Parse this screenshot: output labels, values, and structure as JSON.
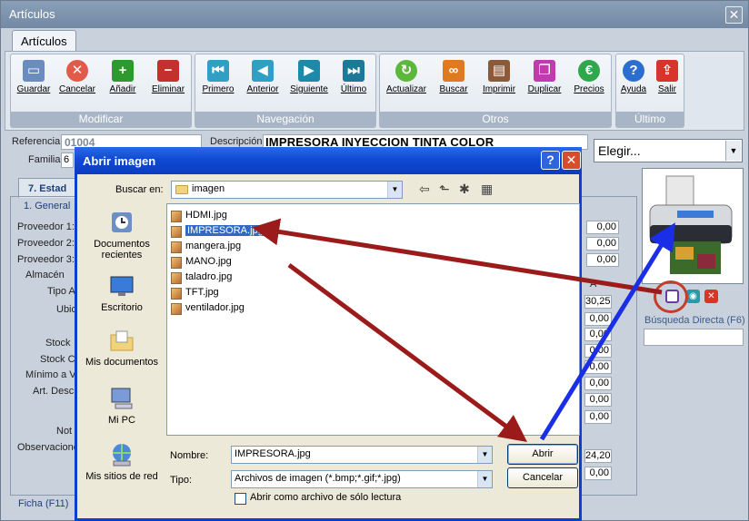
{
  "window": {
    "title": "Artículos",
    "close_glyph": "✕"
  },
  "ribbon": {
    "tab_label": "Artículos",
    "groups": [
      {
        "label": "Modificar",
        "buttons": [
          {
            "label": "Guardar",
            "icon": "save-icon",
            "color": "#6a8cbf"
          },
          {
            "label": "Cancelar",
            "icon": "cancel-icon",
            "color": "#e25a4a"
          },
          {
            "label": "Añadir",
            "icon": "add-icon",
            "color": "#2e9a2e"
          },
          {
            "label": "Eliminar",
            "icon": "delete-icon",
            "color": "#c4302b"
          }
        ]
      },
      {
        "label": "Navegación",
        "buttons": [
          {
            "label": "Primero",
            "icon": "first-icon",
            "color": "#2f9fc4"
          },
          {
            "label": "Anterior",
            "icon": "previous-icon",
            "color": "#2f9fc4"
          },
          {
            "label": "Siguiente",
            "icon": "next-icon",
            "color": "#1c8aa8"
          },
          {
            "label": "Último",
            "icon": "last-icon",
            "color": "#1c7a98"
          }
        ]
      },
      {
        "label": "Otros",
        "buttons": [
          {
            "label": "Actualizar",
            "icon": "refresh-icon",
            "color": "#5cb83a"
          },
          {
            "label": "Buscar",
            "icon": "binoculars-icon",
            "color": "#e07a20"
          },
          {
            "label": "Imprimir",
            "icon": "printer-icon",
            "color": "#8a5a3a"
          },
          {
            "label": "Duplicar",
            "icon": "duplicate-icon",
            "color": "#c03ab0"
          },
          {
            "label": "Precios",
            "icon": "euro-icon",
            "color": "#2ea84a"
          }
        ]
      },
      {
        "label": "Último",
        "buttons": [
          {
            "label": "Ayuda",
            "icon": "help-icon",
            "color": "#2a6fcf"
          },
          {
            "label": "Salir",
            "icon": "exit-icon",
            "color": "#d8342a"
          }
        ]
      }
    ]
  },
  "form": {
    "referencia_label": "Referencia:",
    "referencia_value": "01004",
    "descripcion_label": "Descripción:",
    "descripcion_value": "IMPRESORA INYECCION TINTA COLOR",
    "familia_label": "Familia:",
    "familia_value": "6",
    "elegir_value": "Elegir...",
    "subtab_label": "7. Estad",
    "inner_tab_label": "1. General",
    "side_labels": [
      "Proveedor 1:",
      "Proveedor 2:",
      "Proveedor 3:",
      "Almacén",
      "Tipo A",
      "Ubic",
      "Stock",
      "Stock C",
      "Mínimo a V",
      "Art. Desc",
      "Not",
      "Observacione"
    ],
    "right_values": [
      "0,00",
      "0,00",
      "0,00",
      "30,25",
      "0,00",
      "0,00",
      "0,00",
      "0,00",
      "0,00",
      "0,00",
      "0,00",
      "24,20",
      "0,00"
    ],
    "col_header": "A",
    "busqueda_label": "Búsqueda Directa (F6)",
    "ficha_label": "Ficha (F11)"
  },
  "dialog": {
    "title": "Abrir imagen",
    "help_glyph": "?",
    "close_glyph": "✕",
    "lookin_label": "Buscar en:",
    "lookin_value": "imagen",
    "places": [
      "Documentos recientes",
      "Escritorio",
      "Mis documentos",
      "Mi PC",
      "Mis sitios de red"
    ],
    "files": [
      "HDMI.jpg",
      "IMPRESORA.jpg",
      "mangera.jpg",
      "MANO.jpg",
      "taladro.jpg",
      "TFT.jpg",
      "ventilador.jpg"
    ],
    "selected_file": "IMPRESORA.jpg",
    "nombre_label": "Nombre:",
    "nombre_value": "IMPRESORA.jpg",
    "tipo_label": "Tipo:",
    "tipo_value": "Archivos de imagen (*.bmp;*.gif;*.jpg)",
    "readonly_label": "Abrir como archivo de sólo lectura",
    "open_button": "Abrir",
    "cancel_button": "Cancelar"
  },
  "colors": {
    "annotation_red": "#9b1b1b",
    "annotation_blue": "#1a2ee8",
    "dialog_title": "#0a3fcf"
  }
}
